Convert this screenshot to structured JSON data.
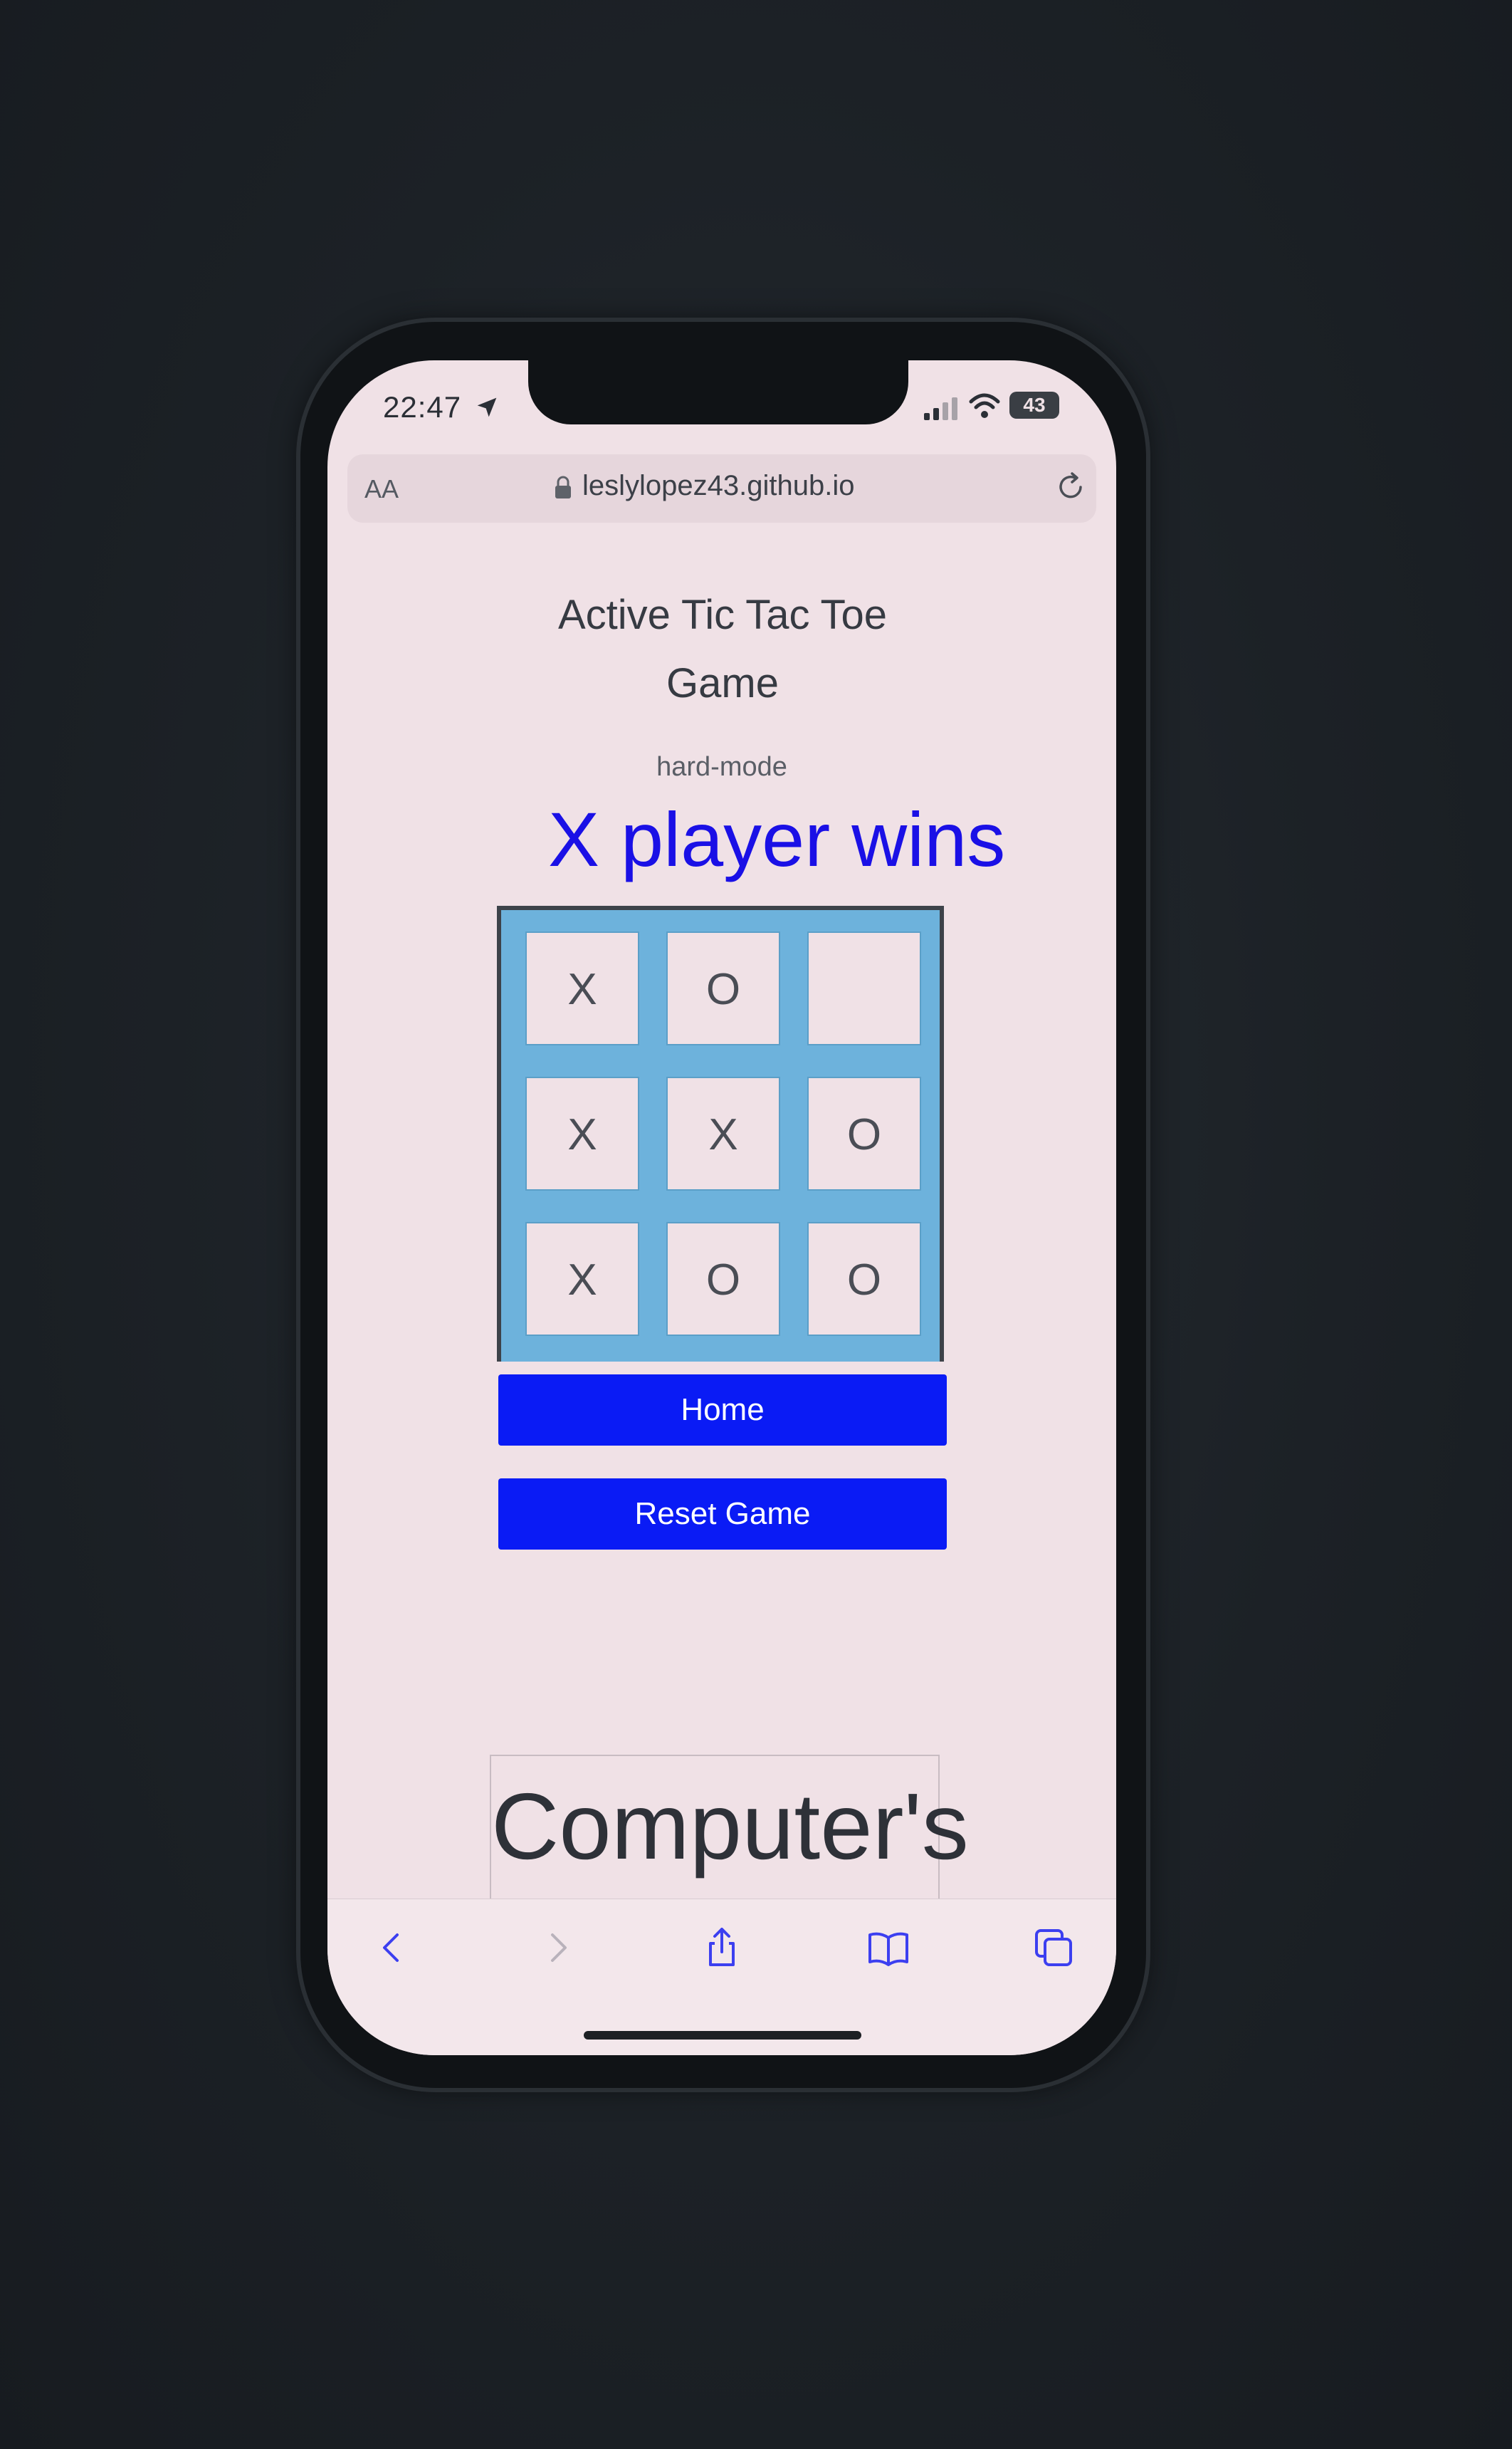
{
  "status_bar": {
    "time": "22:47",
    "battery": "43"
  },
  "browser": {
    "text_size_label": "AA",
    "url": "leslylopez43.github.io"
  },
  "page": {
    "title": "Active Tic Tac Toe Game",
    "mode": "hard-mode",
    "winner_message": "X player wins",
    "board": [
      [
        "X",
        "O",
        ""
      ],
      [
        "X",
        "X",
        "O"
      ],
      [
        "X",
        "O",
        "O"
      ]
    ],
    "home_button": "Home",
    "reset_button": "Reset Game",
    "turn_message": "Computer's turn"
  },
  "toolbar": {
    "icons": [
      "back-icon",
      "forward-icon",
      "share-icon",
      "bookmarks-icon",
      "tabs-icon"
    ]
  },
  "colors": {
    "accent_blue": "#0a1bf5",
    "winner_text": "#1a10e6",
    "board_background": "#6db2dc",
    "page_background": "#f0e1e6"
  }
}
